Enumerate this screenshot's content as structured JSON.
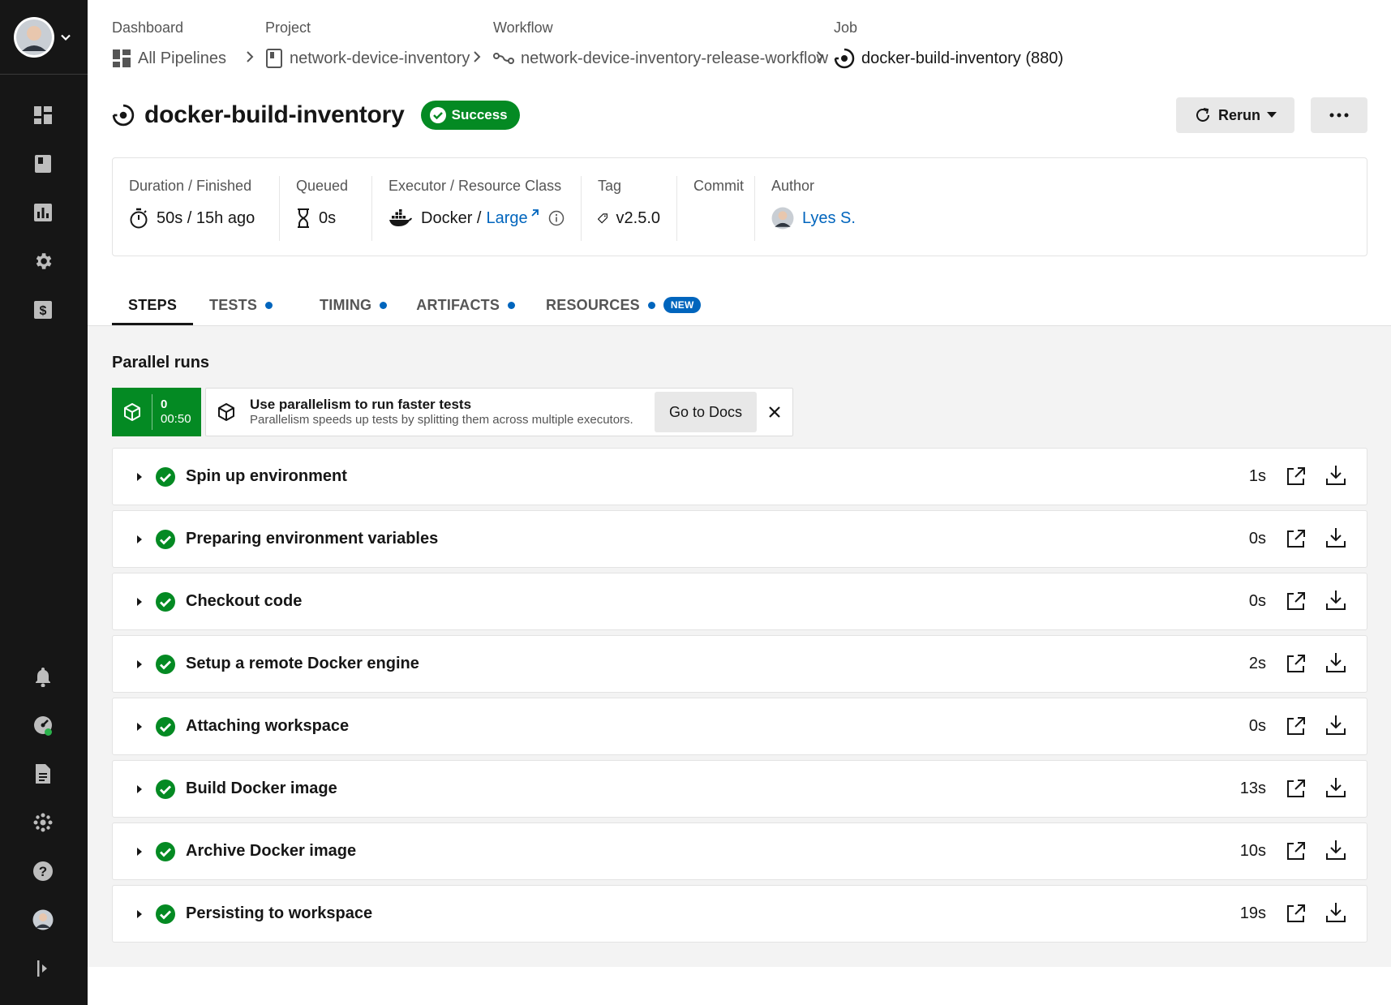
{
  "breadcrumbs": [
    {
      "label": "Dashboard",
      "text": "All Pipelines",
      "icon": "dashboard-icon"
    },
    {
      "label": "Project",
      "text": "network-device-inventory",
      "icon": "project-icon"
    },
    {
      "label": "Workflow",
      "text": "network-device-inventory-release-workflow",
      "icon": "workflow-icon"
    },
    {
      "label": "Job",
      "text": "docker-build-inventory (880)",
      "icon": "job-icon"
    }
  ],
  "job": {
    "title": "docker-build-inventory",
    "status": "Success",
    "status_color": "#048a23"
  },
  "actions": {
    "rerun_label": "Rerun"
  },
  "meta": {
    "duration_label": "Duration / Finished",
    "duration_value": "50s / 15h ago",
    "queued_label": "Queued",
    "queued_value": "0s",
    "executor_label": "Executor / Resource Class",
    "executor_value": "Docker /",
    "resource_class": "Large",
    "tag_label": "Tag",
    "tag_value": "v2.5.0",
    "commit_label": "Commit",
    "author_label": "Author",
    "author_value": "Lyes S."
  },
  "tabs": [
    {
      "label": "STEPS",
      "active": true
    },
    {
      "label": "TESTS",
      "dot": true
    },
    {
      "label": "TIMING",
      "dot": true
    },
    {
      "label": "ARTIFACTS",
      "dot": true
    },
    {
      "label": "RESOURCES",
      "dot": true,
      "badge": "NEW"
    }
  ],
  "parallel": {
    "title": "Parallel runs",
    "run_index": "0",
    "run_time": "00:50",
    "banner_title": "Use parallelism to run faster tests",
    "banner_subtitle": "Parallelism speeds up tests by splitting them across multiple executors.",
    "docs_label": "Go to Docs"
  },
  "steps": [
    {
      "name": "Spin up environment",
      "duration": "1s"
    },
    {
      "name": "Preparing environment variables",
      "duration": "0s"
    },
    {
      "name": "Checkout code",
      "duration": "0s"
    },
    {
      "name": "Setup a remote Docker engine",
      "duration": "2s"
    },
    {
      "name": "Attaching workspace",
      "duration": "0s"
    },
    {
      "name": "Build Docker image",
      "duration": "13s"
    },
    {
      "name": "Archive Docker image",
      "duration": "10s"
    },
    {
      "name": "Persisting to workspace",
      "duration": "19s"
    }
  ],
  "colors": {
    "sidebar_bg": "#161616",
    "success": "#048a23",
    "link": "#0065bd",
    "content_bg": "#f3f3f3"
  }
}
